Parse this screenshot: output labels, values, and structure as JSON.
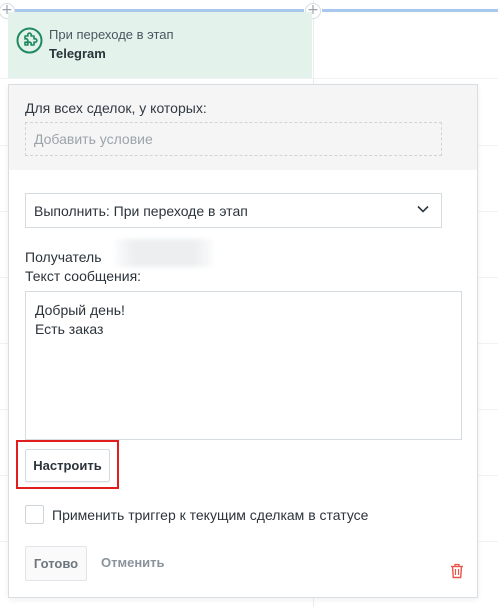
{
  "trigger": {
    "subtitle": "При переходе в этап",
    "title": "Telegram",
    "icon": "puzzle-icon"
  },
  "conditions": {
    "label": "Для всех сделок, у которых:",
    "placeholder": "Добавить условие"
  },
  "action_select": {
    "value": "Выполнить: При переходе в этап"
  },
  "recipient": {
    "label": "Получатель"
  },
  "message": {
    "label": "Текст сообщения:",
    "lines": [
      "Добрый день!",
      "Есть заказ"
    ]
  },
  "buttons": {
    "configure": "Настроить",
    "done": "Готово",
    "cancel": "Отменить"
  },
  "apply_checkbox": {
    "label": "Применить триггер к текущим сделкам в статусе",
    "checked": false
  },
  "colors": {
    "accent_green": "#1f8a5e",
    "highlight_red": "#e11d1d",
    "delete_red": "#e8534a",
    "header_bg": "#e3f3ec"
  }
}
